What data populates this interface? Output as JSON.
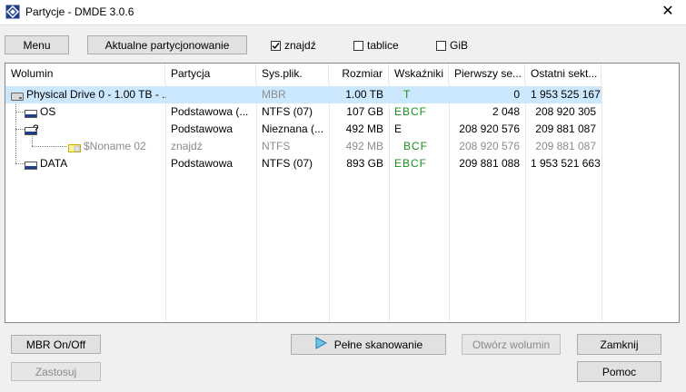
{
  "window": {
    "title": "Partycje - DMDE 3.0.6",
    "close_glyph": "✕",
    "icon": "dmde-app-icon"
  },
  "toolbar": {
    "menu_label": "Menu",
    "current_partitioning_label": "Aktualne partycjonowanie",
    "checkboxes": [
      {
        "label": "znajdź",
        "checked": true
      },
      {
        "label": "tablice",
        "checked": false
      },
      {
        "label": "GiB",
        "checked": false
      }
    ]
  },
  "table": {
    "columns": [
      "Wolumin",
      "Partycja",
      "Sys.plik.",
      "Rozmiar",
      "Wskaźniki",
      "Pierwszy se...",
      "Ostatni sekt..."
    ],
    "rows": [
      {
        "volume": "Physical Drive 0 - 1.00 TB - ...",
        "partition": "",
        "fs": "MBR",
        "size": "1.00 TB",
        "flags": "T",
        "first": "0",
        "last": "1 953 525 167",
        "selected": true,
        "style": "drive"
      },
      {
        "volume": "OS",
        "partition": "Podstawowa (...",
        "fs": "NTFS (07)",
        "size": "107 GB",
        "flags": "EBCF",
        "first": "2 048",
        "last": "208 920 305",
        "selected": false,
        "style": "normal"
      },
      {
        "volume": "?",
        "partition": "Podstawowa",
        "fs": "Nieznana (...",
        "size": "492 MB",
        "flags": "E",
        "first": "208 920 576",
        "last": "209 881 087",
        "selected": false,
        "style": "unknown"
      },
      {
        "volume": "$Noname 02",
        "partition": "znajdź",
        "fs": "NTFS",
        "size": "492 MB",
        "flags": "BCF",
        "first": "208 920 576",
        "last": "209 881 087",
        "selected": false,
        "style": "found"
      },
      {
        "volume": "DATA",
        "partition": "Podstawowa",
        "fs": "NTFS (07)",
        "size": "893 GB",
        "flags": "EBCF",
        "first": "209 881 088",
        "last": "1 953 521 663",
        "selected": false,
        "style": "normal"
      }
    ]
  },
  "buttons": {
    "mbr_toggle": "MBR On/Off",
    "apply": "Zastosuj",
    "full_scan": "Pełne skanowanie",
    "open_volume": "Otwórz wolumin",
    "close": "Zamknij",
    "help": "Pomoc"
  },
  "colors": {
    "selection": "#cce8ff",
    "flags_green": "#1a8f1a",
    "muted_text": "#8c8c8c"
  }
}
